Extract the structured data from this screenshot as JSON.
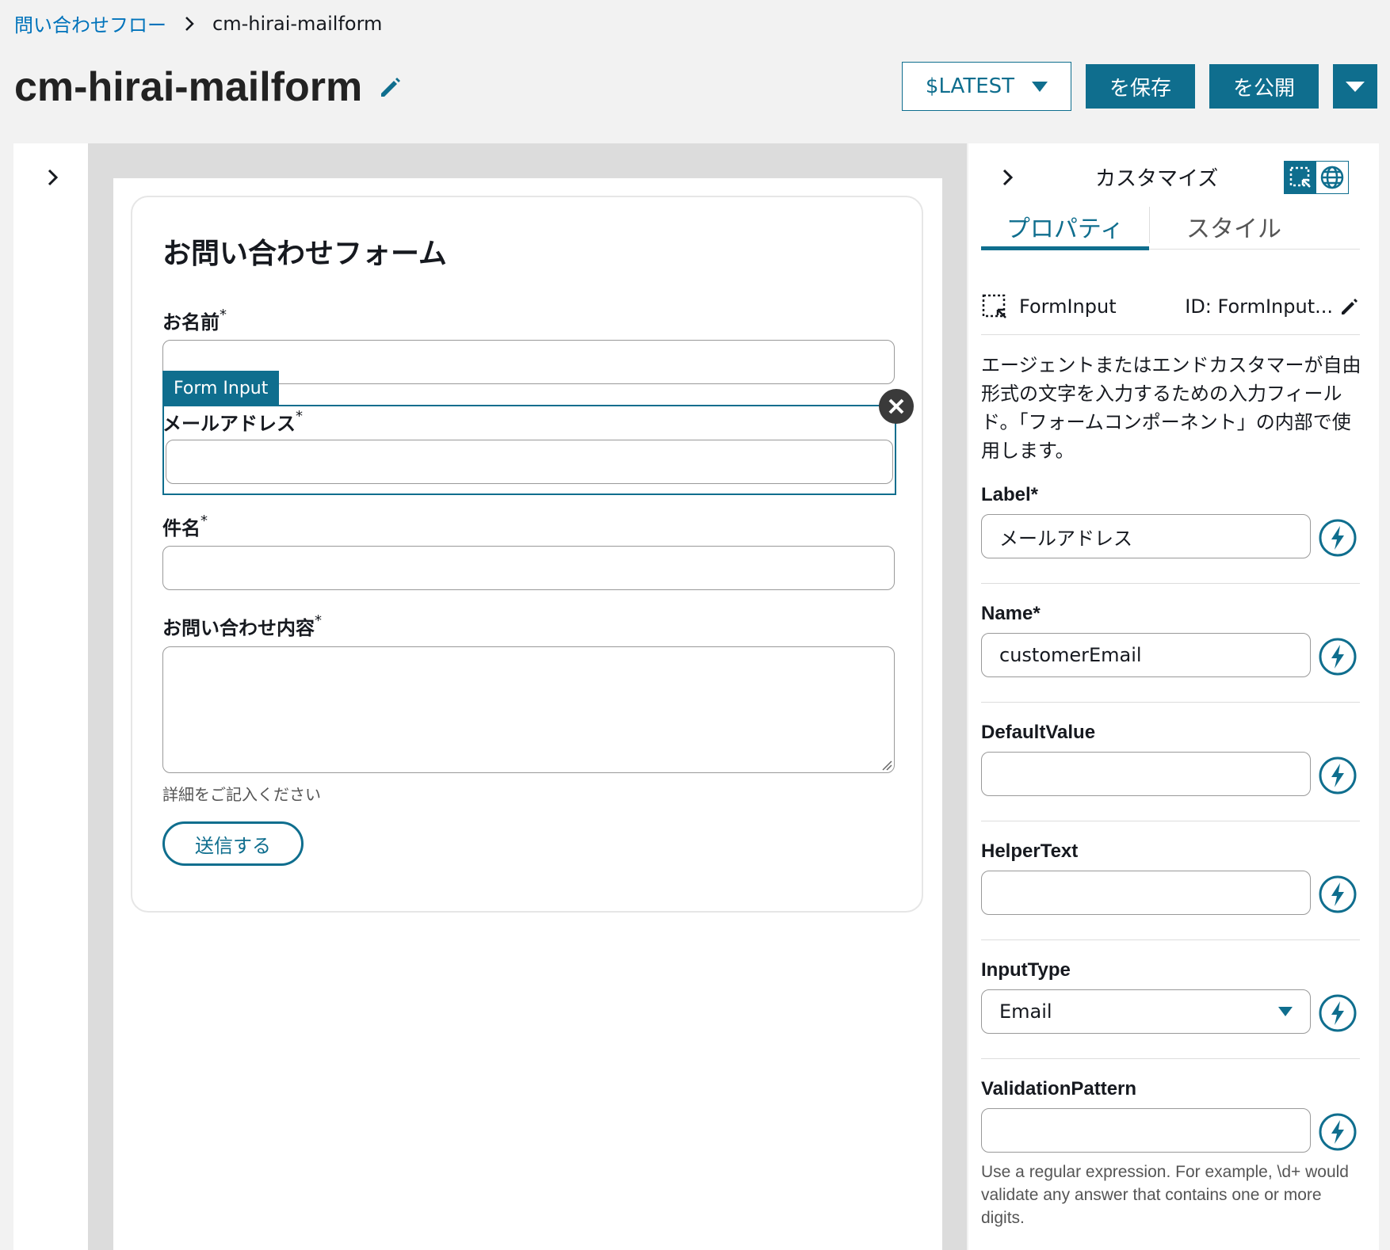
{
  "breadcrumb": {
    "parent": "問い合わせフロー",
    "current": "cm-hirai-mailform"
  },
  "header": {
    "title": "cm-hirai-mailform",
    "version_label": "$LATEST",
    "save_label": "を保存",
    "publish_label": "を公開"
  },
  "form": {
    "title": "お問い合わせフォーム",
    "fields": [
      {
        "label": "お名前",
        "required": "*"
      },
      {
        "label": "メールアドレス",
        "required": "*"
      },
      {
        "label": "件名",
        "required": "*"
      },
      {
        "label": "お問い合わせ内容",
        "required": "*"
      }
    ],
    "helper_text": "詳細をご記入ください",
    "submit_label": "送信する",
    "selected_tag": "Form Input"
  },
  "panel": {
    "title": "カスタマイズ",
    "tabs": [
      "プロパティ",
      "スタイル"
    ],
    "component_name": "FormInput",
    "component_id": "ID: FormInput...",
    "description": "エージェントまたはエンドカスタマーが自由形式の文字を入力するための入力フィールド。「フォームコンポーネント」の内部で使用します。",
    "properties": {
      "label": {
        "name": "Label*",
        "value": "メールアドレス"
      },
      "name": {
        "name": "Name*",
        "value": "customerEmail"
      },
      "default_value": {
        "name": "DefaultValue",
        "value": ""
      },
      "helper_text": {
        "name": "HelperText",
        "value": ""
      },
      "input_type": {
        "name": "InputType",
        "value": "Email"
      },
      "validation_pattern": {
        "name": "ValidationPattern",
        "value": "",
        "help": "Use a regular expression. For example, \\d+ would validate any answer that contains one or more digits."
      }
    }
  },
  "colors": {
    "accent": "#0f6e8e",
    "link": "#0073bb"
  }
}
